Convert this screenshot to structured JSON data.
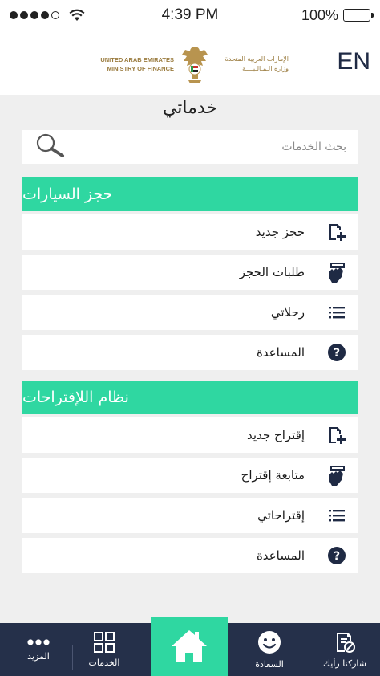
{
  "status_bar": {
    "time": "4:39 PM",
    "battery": "100%",
    "signal_bars": 4,
    "signal_total": 5
  },
  "header": {
    "language_toggle": "EN",
    "logo_en_line1": "UNITED ARAB EMIRATES",
    "logo_en_line2": "MINISTRY OF FINANCE",
    "logo_ar_line1": "الإمارات العربية المتحدة",
    "logo_ar_line2": "وزارة الـمـالـيــــة"
  },
  "page": {
    "title": "خدماتي"
  },
  "search": {
    "placeholder": "بحث الخدمات"
  },
  "sections": [
    {
      "title": "حجز السيارات",
      "items": [
        {
          "label": "حجز جديد",
          "icon": "add-document-icon"
        },
        {
          "label": "طلبات الحجز",
          "icon": "hand-card-icon"
        },
        {
          "label": "رحلاتي",
          "icon": "list-icon"
        },
        {
          "label": "المساعدة",
          "icon": "help-icon"
        }
      ]
    },
    {
      "title": "نظام اللإقتراحات",
      "items": [
        {
          "label": "إقتراح جديد",
          "icon": "add-document-icon"
        },
        {
          "label": "متابعة إقتراح",
          "icon": "hand-card-icon"
        },
        {
          "label": "إقتراحاتي",
          "icon": "list-icon"
        },
        {
          "label": "المساعدة",
          "icon": "help-icon"
        }
      ]
    }
  ],
  "bottom_nav": {
    "share": "شاركنا رأيك",
    "happiness": "السعادة",
    "home": "home-icon",
    "services": "الخدمات",
    "more": "المزيد"
  },
  "colors": {
    "accent": "#2fd7a1",
    "nav_bg": "#25304a",
    "page_bg": "#efefef",
    "gold": "#9a7b3e"
  }
}
